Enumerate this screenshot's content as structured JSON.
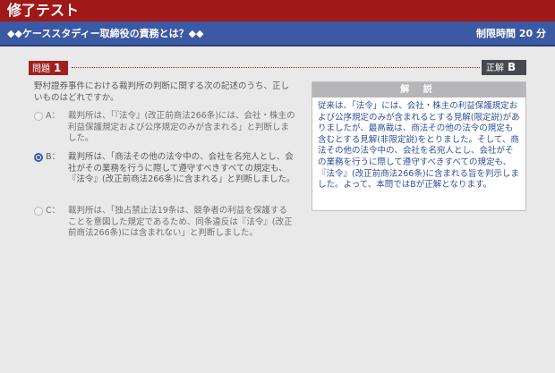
{
  "header": {
    "brand_kanji": "修了",
    "brand_kata": "テスト",
    "course_title": "◆◆ケーススタディー取締役の責務とは？◆◆",
    "timer": "制限時間 20 分"
  },
  "question": {
    "label": "問題",
    "number": "1",
    "text": "野村證券事件における裁判所の判断に関する次の記述のうち、正しいものはどれですか。"
  },
  "answer": {
    "label": "正解",
    "value": "B"
  },
  "options": [
    {
      "label": "A：",
      "text": "裁判所は、「『法令』(改正前商法266条)には、会社・株主の利益保護規定および公序規定のみが含まれる」と判断しました。",
      "selected": false
    },
    {
      "label": "B：",
      "text": "裁判所は、「商法その他の法令中の、会社を名宛人とし、会社がその業務を行うに際して遵守すべきすべての規定も、『法令』(改正前商法266条)に含まれる」と判断しました。",
      "selected": true
    },
    {
      "label": "C：",
      "text": "裁判所は、「独占禁止法19条は、競争者の利益を保護することを意図した規定であるため、同条違反は『法令』(改正前商法266条)には含まれない」と判断しました。",
      "selected": false
    }
  ],
  "explanation": {
    "title": "解 説",
    "text": "従来は、「法令」には、会社・株主の利益保護規定および公序規定のみが含まれるとする見解(限定説)がありましたが、最高裁は、商法その他の法令の規定も含むとする見解(非限定説)をとりました。そして、商法その他の法令中の、会社を名宛人とし、会社がその業務を行うに際して遵守すべきすべての規定も、『法令』(改正前商法266条)に含まれる旨を判示しました。よって、本問ではBが正解となります。"
  },
  "colors": {
    "header_red": "#a01818",
    "title_blue": "#3c5aa4",
    "explanation_text": "#2f4f9a"
  }
}
